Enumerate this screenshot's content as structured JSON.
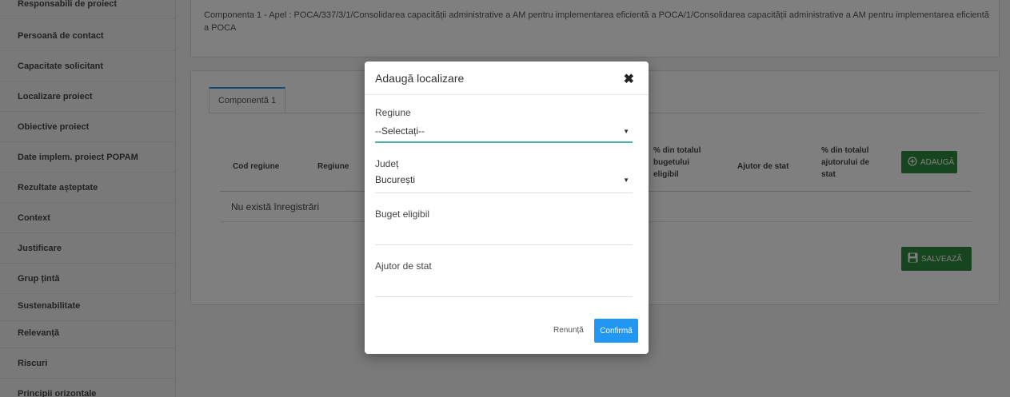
{
  "sidebar": {
    "items": [
      {
        "label": "Responsabili de proiect"
      },
      {
        "label": "Persoană de contact"
      },
      {
        "label": "Capacitate solicitant"
      },
      {
        "label": "Localizare proiect"
      },
      {
        "label": "Obiective proiect"
      },
      {
        "label": "Date implem. proiect POPAM"
      },
      {
        "label": "Rezultate așteptate"
      },
      {
        "label": "Context"
      },
      {
        "label": "Justificare"
      },
      {
        "label": "Grup țintă"
      },
      {
        "label": "Sustenabilitate"
      },
      {
        "label": "Relevanță"
      },
      {
        "label": "Riscuri"
      },
      {
        "label": "Principii orizontale"
      }
    ]
  },
  "main": {
    "component_description": "Componenta 1 - Apel : POCA/337/3/1/Consolidarea capacității administrative a AM pentru implementarea eficientă a POCA/1/Consolidarea capacității administrative a AM pentru implementarea eficientă a POCA",
    "tab_label": "Componentă 1",
    "table": {
      "headers": [
        "Cod regiune",
        "Regiune",
        "% din totalul bugetului eligibil",
        "Ajutor de stat",
        "% din totalul ajutorului de stat"
      ],
      "empty_text": "Nu există înregistrări"
    },
    "add_button_label": "ADAUGĂ",
    "save_button_label": "SALVEAZĂ"
  },
  "modal": {
    "title": "Adaugă localizare",
    "close_symbol": "✖",
    "fields": {
      "region_label": "Regiune",
      "region_value": "--Selectați--",
      "county_label": "Județ",
      "county_value": "București",
      "budget_label": "Buget eligibil",
      "budget_value": "",
      "state_aid_label": "Ajutor de stat",
      "state_aid_value": ""
    },
    "cancel_label": "Renunță",
    "confirm_label": "Confirmă"
  },
  "colors": {
    "primary": "#2196f3",
    "success": "#2e8b3e",
    "focus_underline": "#4db6ac"
  }
}
